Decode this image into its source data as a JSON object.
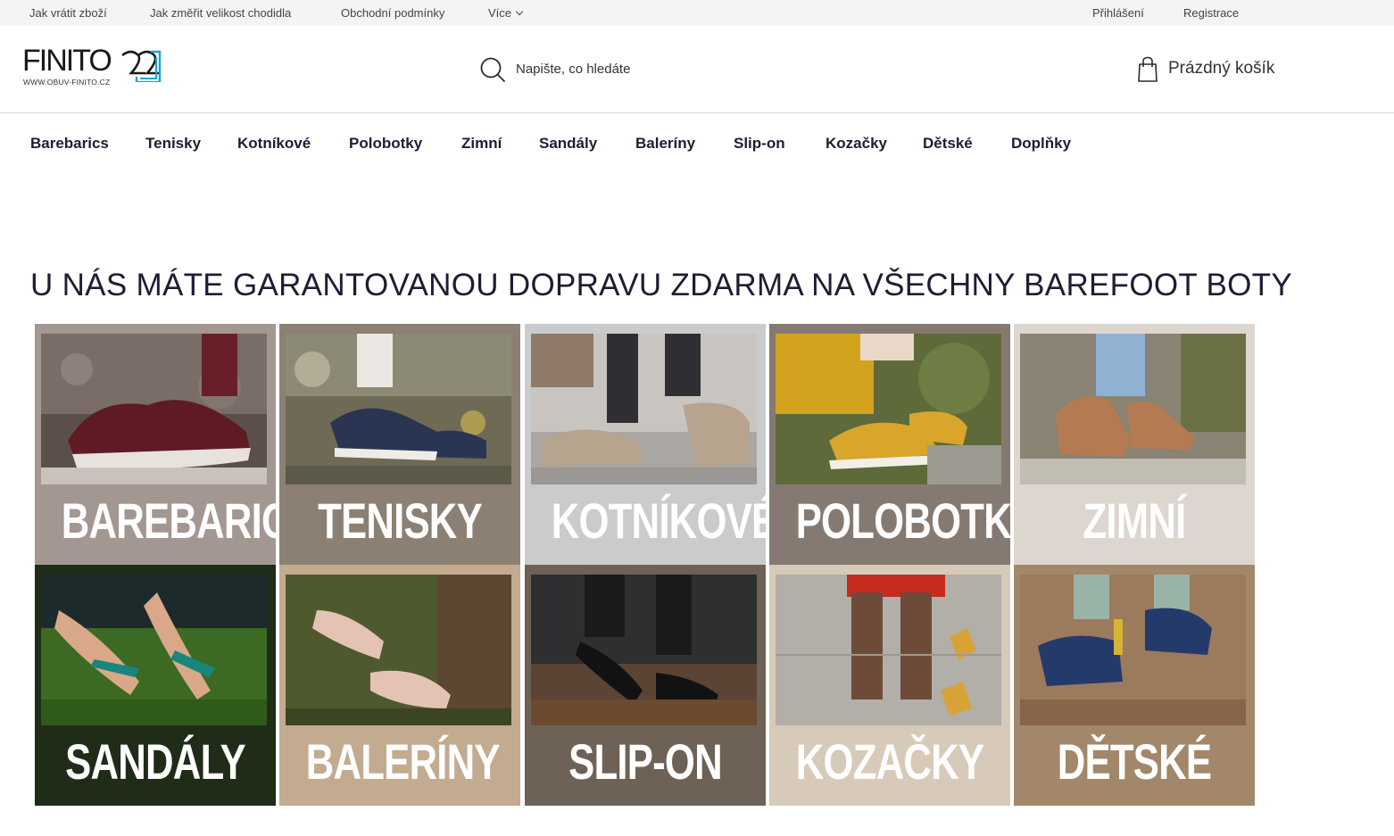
{
  "topbar": {
    "links": [
      "Jak vrátit zboží",
      "Jak změřit velikost chodidla",
      "Obchodní podmínky",
      "Více"
    ],
    "login": "Přihlášení",
    "register": "Registrace"
  },
  "logo": {
    "text": "FINITO",
    "url": "WWW.OBUV-FINITO.CZ"
  },
  "search": {
    "placeholder": "Napište, co hledáte"
  },
  "cart": {
    "label": "Prázdný košík"
  },
  "nav": {
    "items": [
      "Barebarics",
      "Tenisky",
      "Kotníkové",
      "Polobotky",
      "Zimní",
      "Sandály",
      "Baleríny",
      "Slip-on",
      "Kozačky",
      "Dětské",
      "Doplňky"
    ]
  },
  "headline": "U NÁS MÁTE GARANTOVANOU DOPRAVU ZDARMA NA VŠECHNY BAREFOOT BOTY",
  "tiles": [
    {
      "label": "BAREBARICS",
      "bg": "#a39791"
    },
    {
      "label": "TENISKY",
      "bg": "#8c7f74"
    },
    {
      "label": "KOTNÍKOVÉ",
      "bg": "#c9cbcd"
    },
    {
      "label": "POLOBOTKY",
      "bg": "#857a71"
    },
    {
      "label": "ZIMNÍ",
      "bg": "#ddd6cf"
    },
    {
      "label": "SANDÁLY",
      "bg": "#1e2c18"
    },
    {
      "label": "BALERÍNY",
      "bg": "#c2ab8f"
    },
    {
      "label": "SLIP-ON",
      "bg": "#6d6255"
    },
    {
      "label": "KOZAČKY",
      "bg": "#d7cab9"
    },
    {
      "label": "DĚTSKÉ",
      "bg": "#a2876a"
    }
  ]
}
